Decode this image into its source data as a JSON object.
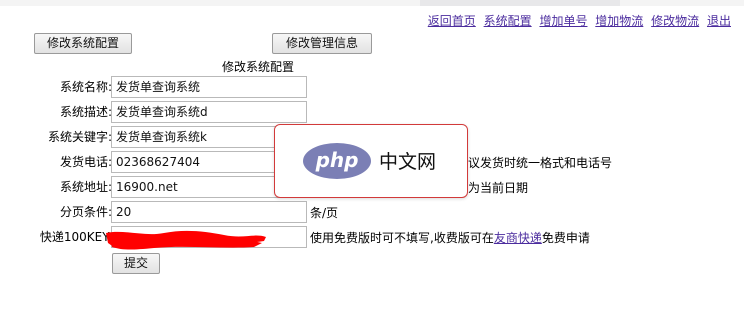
{
  "topnav": {
    "links": [
      "返回首页",
      "系统配置",
      "增加单号",
      "增加物流",
      "修改物流",
      "退出"
    ]
  },
  "buttons": {
    "edit_system": "修改系统配置",
    "edit_admin": "修改管理信息",
    "submit": "提交"
  },
  "section_title": "修改系统配置",
  "form": {
    "rows": [
      {
        "label": "系统名称:",
        "value": "发货单查询系统",
        "note": ""
      },
      {
        "label": "系统描述:",
        "value": "发货单查询系统d",
        "note": ""
      },
      {
        "label": "系统关键字:",
        "value": "发货单查询系统k",
        "note": ""
      },
      {
        "label": "发货电话:",
        "value": "02368627404",
        "note": "议发货时统一格式和电话号"
      },
      {
        "label": "系统地址:",
        "value": "16900.net",
        "note": "为当前日期"
      },
      {
        "label": "分页条件:",
        "value": "20",
        "note": "条/页"
      },
      {
        "label": "快递100KEY:",
        "value": "",
        "note_pre": "使用免费版时可不填写,收费版可在",
        "note_link": "友商快递",
        "note_post": "免费申请"
      }
    ]
  },
  "overlay": {
    "logo_text": "php",
    "site_text": "中文网"
  },
  "colors": {
    "link": "#4b2c9e",
    "redaction": "#ff0000",
    "logo": "#7b7fb5",
    "overlay_border": "#d23a3a"
  }
}
